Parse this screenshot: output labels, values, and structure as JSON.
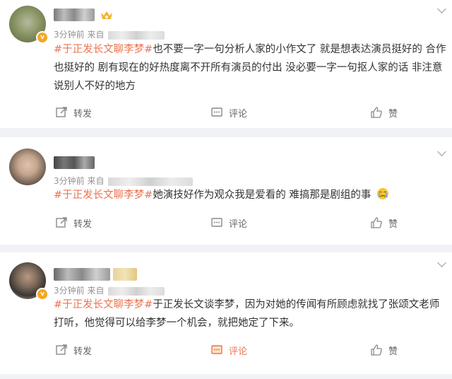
{
  "colors": {
    "hashtag": "#eb7350",
    "badge": "#f5a623",
    "meta": "#939393"
  },
  "posts": [
    {
      "time": "3分钟前",
      "source_prefix": "来自",
      "hashtag": "#于正发长文聊李梦#",
      "text": "也不要一字一句分析人家的小作文了 就是想表达演员挺好的 合作也挺好的 剧有现在的好热度离不开所有演员的付出 没必要一字一句抠人家的话 非注意说别人不好的地方",
      "actions": {
        "repost": "转发",
        "comment": "评论",
        "like": "赞"
      },
      "comment_active": false
    },
    {
      "time": "3分钟前",
      "source_prefix": "来自",
      "hashtag": "#于正发长文聊李梦#",
      "text": "她演技好作为观众我是爱看的 难搞那是剧组的事",
      "emoji": "crying-emoji",
      "actions": {
        "repost": "转发",
        "comment": "评论",
        "like": "赞"
      },
      "comment_active": false
    },
    {
      "time": "3分钟前",
      "source_prefix": "来自",
      "hashtag": "#于正发长文聊李梦#",
      "text": "于正发长文谈李梦，因为对她的传闻有所顾虑就找了张颂文老师打听，他觉得可以给李梦一个机会，就把她定了下来。",
      "actions": {
        "repost": "转发",
        "comment": "评论",
        "like": "赞"
      },
      "comment_active": true
    }
  ]
}
